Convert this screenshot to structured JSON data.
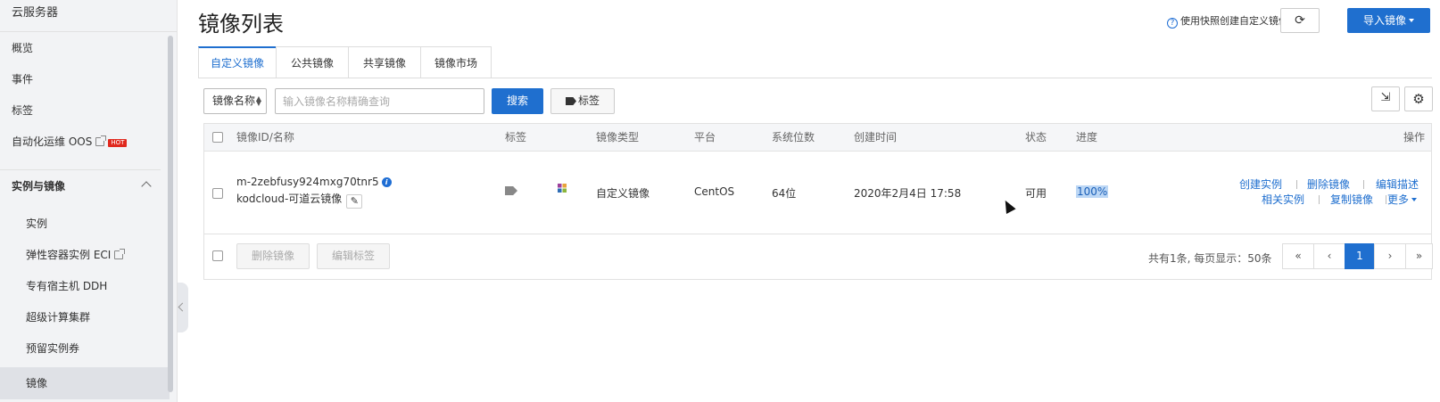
{
  "sidebar": {
    "title": "云服务器",
    "items": [
      {
        "label": "概览"
      },
      {
        "label": "事件"
      },
      {
        "label": "标签"
      },
      {
        "label": "自动化运维 OOS",
        "badge": "HOT"
      }
    ],
    "group": {
      "label": "实例与镜像"
    },
    "sub_items": [
      {
        "label": "实例"
      },
      {
        "label": "弹性容器实例 ECI"
      },
      {
        "label": "专有宿主机 DDH"
      },
      {
        "label": "超级计算集群"
      },
      {
        "label": "预留实例券"
      },
      {
        "label": "镜像"
      }
    ]
  },
  "header": {
    "title": "镜像列表",
    "help_link": "使用快照创建自定义镜像",
    "import_button": "导入镜像"
  },
  "tabs": [
    {
      "label": "自定义镜像"
    },
    {
      "label": "公共镜像"
    },
    {
      "label": "共享镜像"
    },
    {
      "label": "镜像市场"
    }
  ],
  "filter": {
    "select_label": "镜像名称",
    "search_placeholder": "输入镜像名称精确查询",
    "search_button": "搜索",
    "tag_button": "标签"
  },
  "table": {
    "columns": [
      "镜像ID/名称",
      "标签",
      "镜像类型",
      "平台",
      "系统位数",
      "创建时间",
      "状态",
      "进度",
      "操作"
    ],
    "rows": [
      {
        "id": "m-2zebfusy924mxg70tnr5",
        "name": "kodcloud-可道云镜像",
        "type": "自定义镜像",
        "platform": "CentOS",
        "bits": "64位",
        "created": "2020年2月4日 17:58",
        "status": "可用",
        "progress": "100%",
        "actions": {
          "create_instance": "创建实例",
          "delete_image": "删除镜像",
          "edit_description": "编辑描述",
          "related_instances": "相关实例",
          "copy_image": "复制镜像",
          "more": "更多"
        }
      }
    ],
    "footer": {
      "delete_button": "删除镜像",
      "edit_tags_button": "编辑标签",
      "pagination_text": "共有1条, 每页显示：50条",
      "first": "«",
      "prev": "‹",
      "current_page": "1",
      "next": "›",
      "last": "»"
    }
  },
  "colors": {
    "accent": "#1f6fcf",
    "hot_badge": "#e0281d",
    "progress_highlight": "#bcd7f5"
  }
}
